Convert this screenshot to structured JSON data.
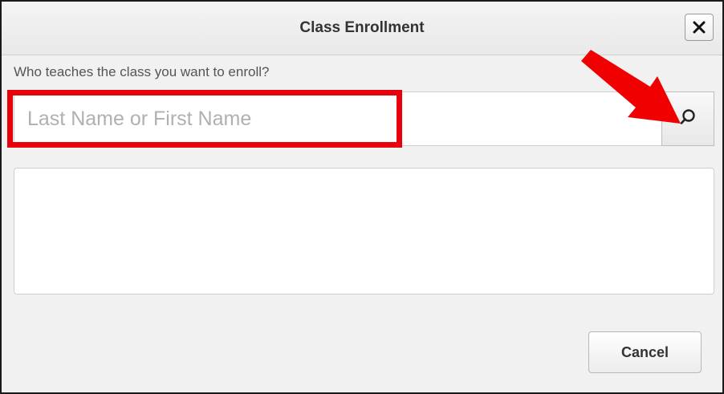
{
  "dialog": {
    "title": "Class Enrollment",
    "close_icon": "close-icon"
  },
  "form": {
    "question": "Who teaches the class you want to enroll?",
    "search_placeholder": "Last Name or First Name",
    "search_value": "",
    "search_icon": "search-icon"
  },
  "results": {
    "items": []
  },
  "footer": {
    "cancel_label": "Cancel"
  },
  "annotations": {
    "highlight_color": "#e8000d",
    "arrow_color": "#f00000",
    "arrow_icon": "arrow-annotation-icon"
  }
}
